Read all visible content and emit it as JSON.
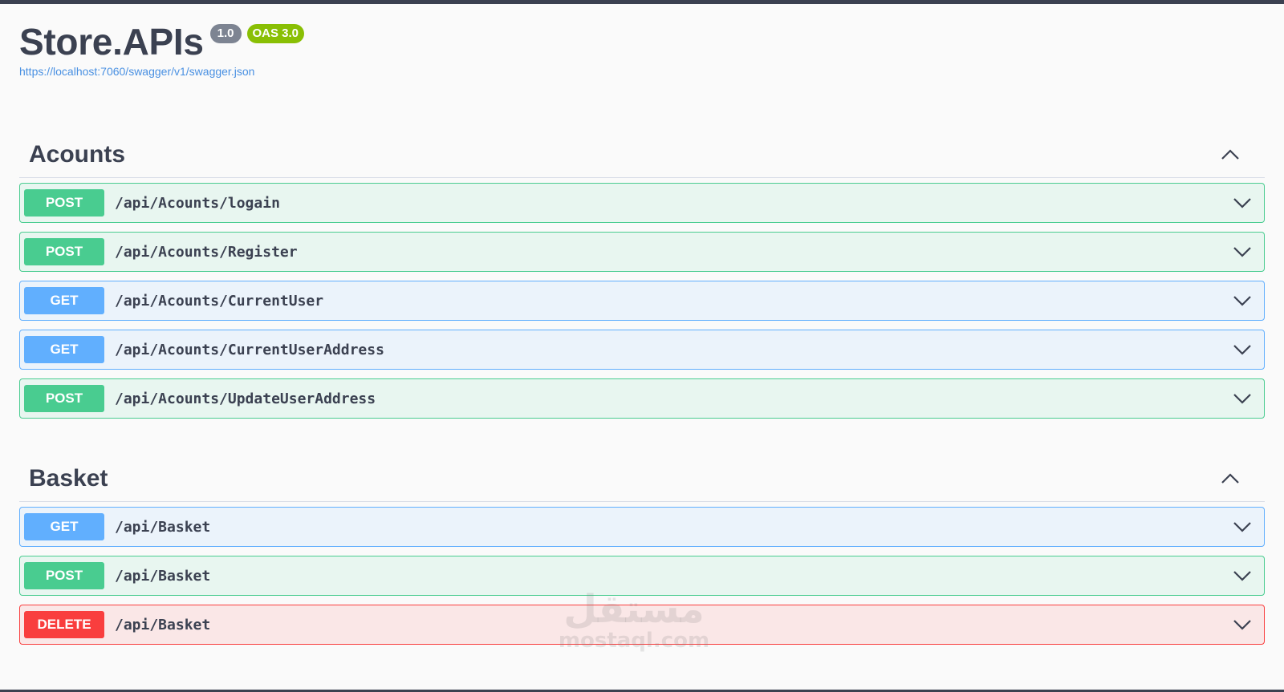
{
  "header": {
    "title": "Store.APIs",
    "version_badge": "1.0",
    "oas_badge": "OAS 3.0",
    "spec_url": "https://localhost:7060/swagger/v1/swagger.json"
  },
  "sections": [
    {
      "title": "Acounts",
      "operations": [
        {
          "method": "POST",
          "path": "/api/Acounts/logain"
        },
        {
          "method": "POST",
          "path": "/api/Acounts/Register"
        },
        {
          "method": "GET",
          "path": "/api/Acounts/CurrentUser"
        },
        {
          "method": "GET",
          "path": "/api/Acounts/CurrentUserAddress"
        },
        {
          "method": "POST",
          "path": "/api/Acounts/UpdateUserAddress"
        }
      ]
    },
    {
      "title": "Basket",
      "operations": [
        {
          "method": "GET",
          "path": "/api/Basket"
        },
        {
          "method": "POST",
          "path": "/api/Basket"
        },
        {
          "method": "DELETE",
          "path": "/api/Basket"
        }
      ]
    }
  ],
  "watermark": {
    "arabic": "مستقل",
    "latin": "mostaql.com"
  },
  "colors": {
    "post": "#49cc90",
    "get": "#61affe",
    "delete": "#f93e3e",
    "oas_badge": "#89bf04",
    "version_badge": "#7d8492",
    "link": "#4990e2"
  },
  "icons": {
    "section_toggle": "chevron-up-icon",
    "operation_toggle": "chevron-down-icon"
  }
}
